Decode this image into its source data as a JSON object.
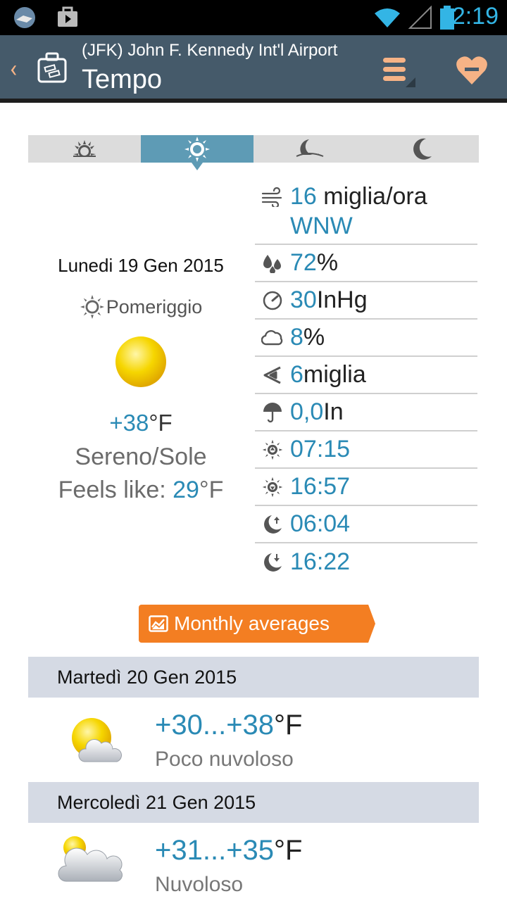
{
  "status_bar": {
    "time": "2:19"
  },
  "action_bar": {
    "subtitle": "(JFK) John F. Kennedy Int'l Airport",
    "title": "Tempo"
  },
  "period_tabs": [
    {
      "icon": "sunrise-icon",
      "active": false
    },
    {
      "icon": "sun-icon",
      "active": true
    },
    {
      "icon": "moonset-icon",
      "active": false
    },
    {
      "icon": "moon-icon",
      "active": false
    }
  ],
  "current": {
    "date": "Lunedi 19 Gen 2015",
    "period": "Pomeriggio",
    "temp_value": "+38",
    "temp_unit": "°F",
    "condition": "Sereno/Sole",
    "feels_label": "Feels like: ",
    "feels_value": "29",
    "feels_unit": "°F"
  },
  "details": {
    "wind_speed": "16",
    "wind_unit": " miglia/ora",
    "wind_dir": "WNW",
    "humidity": "72",
    "humidity_unit": "%",
    "pressure": "30",
    "pressure_unit": " InHg",
    "cloud": "8",
    "cloud_unit": "%",
    "visibility": "6",
    "visibility_unit": " miglia",
    "precip": "0,0",
    "precip_unit": " In",
    "sunrise": "07:15",
    "sunset": "16:57",
    "moonrise": "06:04",
    "moonset": "16:22"
  },
  "monthly_button": "Monthly averages",
  "forecast": [
    {
      "date": "Martedì 20 Gen 2015",
      "temp": "+30...+38",
      "unit": "°F",
      "condition": "Poco nuvoloso"
    },
    {
      "date": "Mercoledì 21 Gen 2015",
      "temp": "+31...+35",
      "unit": "°F",
      "condition": "Nuvoloso"
    }
  ],
  "colors": {
    "accent_blue": "#2a8ab5",
    "action_bar": "#455a6a",
    "button_orange": "#f37e22",
    "tab_active": "#5e9bb5"
  }
}
